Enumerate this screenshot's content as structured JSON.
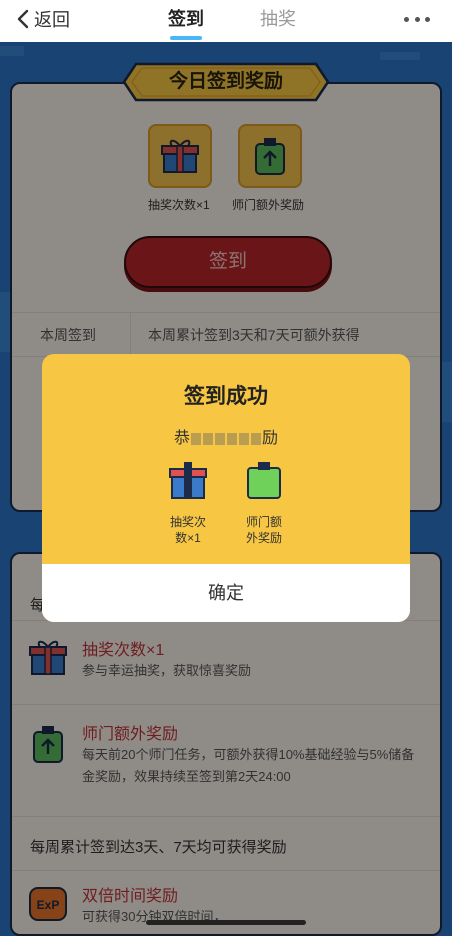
{
  "nav": {
    "back_label": "返回",
    "tabs": [
      {
        "label": "签到",
        "active": true
      },
      {
        "label": "抽奖",
        "active": false
      }
    ],
    "accent_color": "#49b6f5"
  },
  "signin_card": {
    "banner_title": "今日签到奖励",
    "rewards": [
      {
        "icon": "gift-icon",
        "label": "抽奖次数×1"
      },
      {
        "icon": "green-bag-icon",
        "label": "师门额外奖励"
      }
    ],
    "sign_button_label": "签到",
    "week_label": "本周签到",
    "week_desc": "本周累计签到3天和7天可额外获得"
  },
  "details_card": {
    "head": "每",
    "items": [
      {
        "icon": "gift-icon",
        "title": "抽奖次数×1",
        "desc": "参与幸运抽奖，获取惊喜奖励"
      },
      {
        "icon": "green-bag-icon",
        "title": "师门额外奖励",
        "desc": "每天前20个师门任务，可额外获得10%基础经验与5%储备金奖励，效果持续至签到第2天24:00"
      }
    ],
    "weekly_head": "每周累计签到达3天、7天均可获得奖励",
    "weekly_items": [
      {
        "icon": "exp-icon",
        "title": "双倍时间奖励",
        "desc": "可获得30分钟双倍时间，"
      }
    ]
  },
  "modal": {
    "title": "签到成功",
    "subtitle_start": "恭",
    "subtitle_end": "励",
    "rewards": [
      {
        "icon": "gift-icon",
        "label": "抽奖次数×1",
        "label_shown": "抽奖次\n数×1"
      },
      {
        "icon": "green-bag-icon",
        "label": "师门额外奖励",
        "label_shown": "师门额\n外奖励"
      }
    ],
    "confirm_label": "确定"
  },
  "colors": {
    "page_bg": "#2a74c4",
    "modal_bg": "#f7c743",
    "sign_button": "#b7262b",
    "item_title": "#c0333a"
  }
}
